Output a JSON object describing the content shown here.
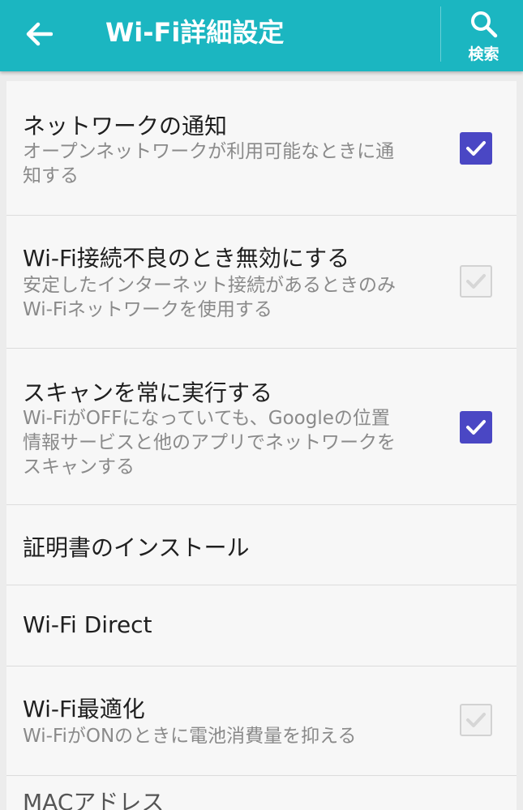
{
  "appbar": {
    "title": "Wi-Fi詳細設定",
    "search_label": "検索"
  },
  "items": [
    {
      "title": "ネットワークの通知",
      "subtitle_lines": [
        "オープンネットワークが利用可能なときに通",
        "知する"
      ],
      "checked": true,
      "enabled": true
    },
    {
      "title": "Wi-Fi接続不良のとき無効にする",
      "subtitle_lines": [
        "安定したインターネット接続があるときのみ",
        "Wi-Fiネットワークを使用する"
      ],
      "checked": true,
      "enabled": false
    },
    {
      "title": "スキャンを常に実行する",
      "subtitle_lines": [
        "Wi-FiがOFFになっていても、Googleの位置",
        "情報サービスと他のアプリでネットワークを",
        "スキャンする"
      ],
      "checked": true,
      "enabled": true
    },
    {
      "title": "証明書のインストール"
    },
    {
      "title": "Wi-Fi Direct"
    },
    {
      "title": "Wi-Fi最適化",
      "subtitle_lines": [
        "Wi-FiがONのときに電池消費量を抑える"
      ],
      "checked": true,
      "enabled": false
    },
    {
      "title": "MACアドレス"
    }
  ],
  "colors": {
    "appbar": "#1bb6c1",
    "checkbox_on": "#4a47c4",
    "checkbox_disabled": "#d2d2d2"
  }
}
